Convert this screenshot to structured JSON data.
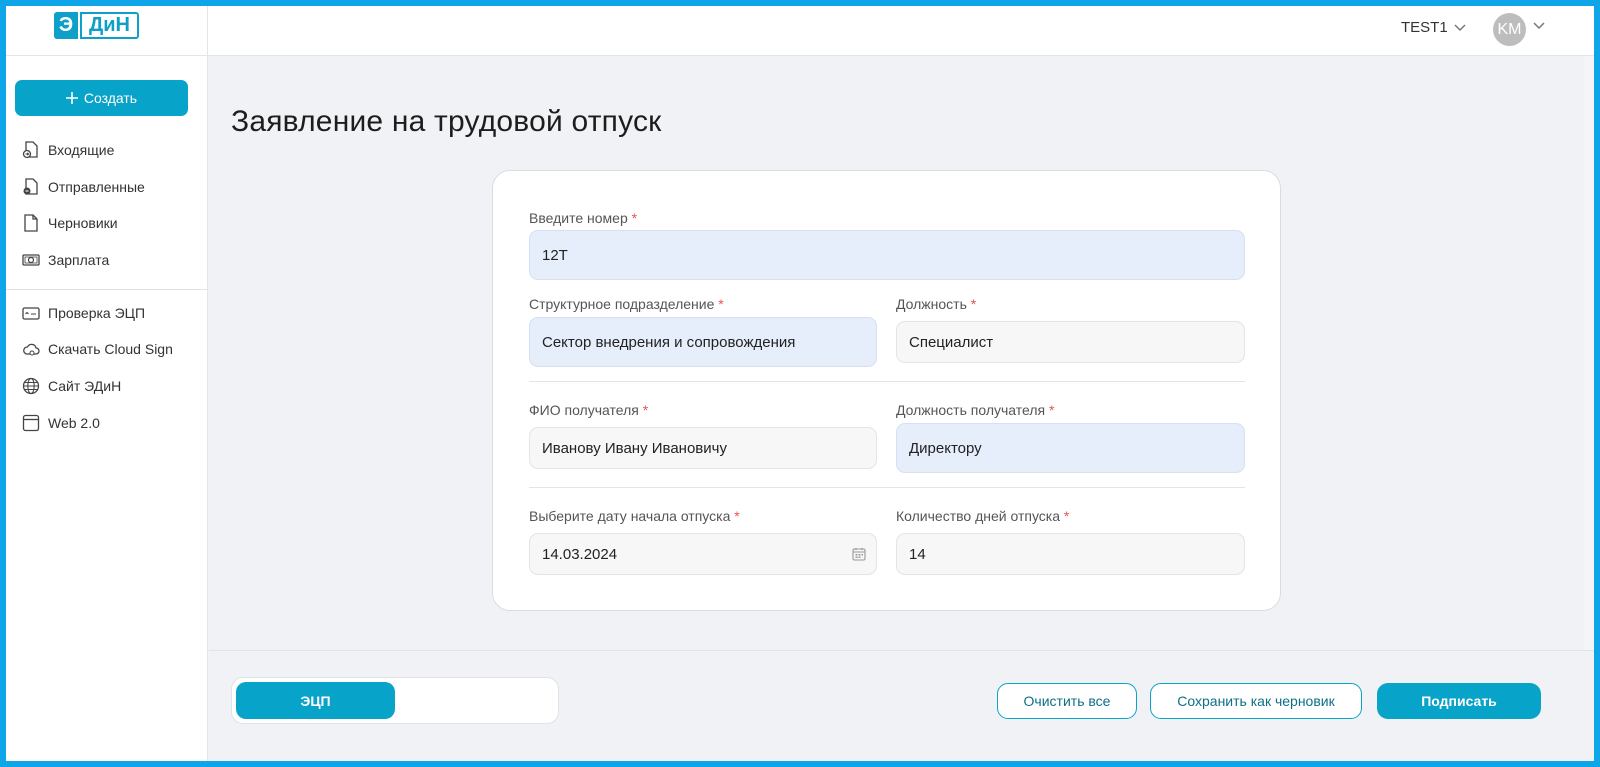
{
  "header": {
    "logo": {
      "part1": "Э",
      "part2": "ДиН"
    },
    "org_name": "TEST1",
    "avatar_initials": "KM"
  },
  "sidebar": {
    "create_label": "Создать",
    "items": [
      {
        "label": "Входящие",
        "icon": "inbox-doc-icon"
      },
      {
        "label": "Отправленные",
        "icon": "sent-doc-icon"
      },
      {
        "label": "Черновики",
        "icon": "draft-doc-icon"
      },
      {
        "label": "Зарплата",
        "icon": "money-icon"
      }
    ],
    "items2": [
      {
        "label": "Проверка ЭЦП",
        "icon": "signature-check-icon"
      },
      {
        "label": "Скачать Cloud Sign",
        "icon": "cloud-icon"
      },
      {
        "label": "Сайт ЭДиН",
        "icon": "globe-icon"
      },
      {
        "label": "Web 2.0",
        "icon": "window-icon"
      }
    ]
  },
  "page": {
    "title": "Заявление на трудовой отпуск"
  },
  "form": {
    "number": {
      "label": "Введите номер",
      "value": "12T"
    },
    "department": {
      "label": "Структурное подразделение",
      "value": "Сектор внедрения и сопровождения"
    },
    "position": {
      "label": "Должность",
      "value": "Специалист"
    },
    "recipient_name": {
      "label": "ФИО получателя",
      "value": "Иванову Ивану Ивановичу"
    },
    "recipient_position": {
      "label": "Должность получателя",
      "value": "Директору"
    },
    "start_date": {
      "label": "Выберите дату начала отпуска",
      "value": "14.03.2024"
    },
    "days": {
      "label": "Количество дней отпуска",
      "value": "14"
    },
    "required_mark": "*"
  },
  "footer": {
    "toggle_label": "ЭЦП",
    "clear_label": "Очистить все",
    "save_draft_label": "Сохранить как черновик",
    "sign_label": "Подписать"
  },
  "colors": {
    "accent": "#08a3c8",
    "frame": "#0ea5e9",
    "filled_field": "#e6eefc",
    "required": "#e25555"
  }
}
